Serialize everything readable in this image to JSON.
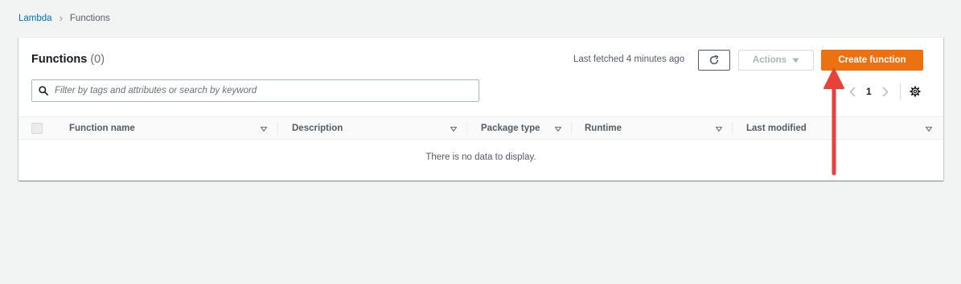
{
  "breadcrumb": {
    "root": "Lambda",
    "current": "Functions"
  },
  "panel": {
    "title": "Functions",
    "count": "(0)",
    "last_fetched": "Last fetched 4 minutes ago",
    "actions_label": "Actions",
    "create_label": "Create function"
  },
  "search": {
    "placeholder": "Filter by tags and attributes or search by keyword"
  },
  "pagination": {
    "current_page": "1"
  },
  "table": {
    "columns": [
      "Function name",
      "Description",
      "Package type",
      "Runtime",
      "Last modified"
    ],
    "empty_message": "There is no data to display."
  },
  "icons": {
    "refresh": "refresh-icon",
    "search": "search-icon",
    "settings": "gear-icon",
    "sort": "sort-caret-icon"
  },
  "colors": {
    "primary_button": "#ec7211",
    "link": "#0073bb",
    "annotation_arrow": "#e8413b"
  }
}
